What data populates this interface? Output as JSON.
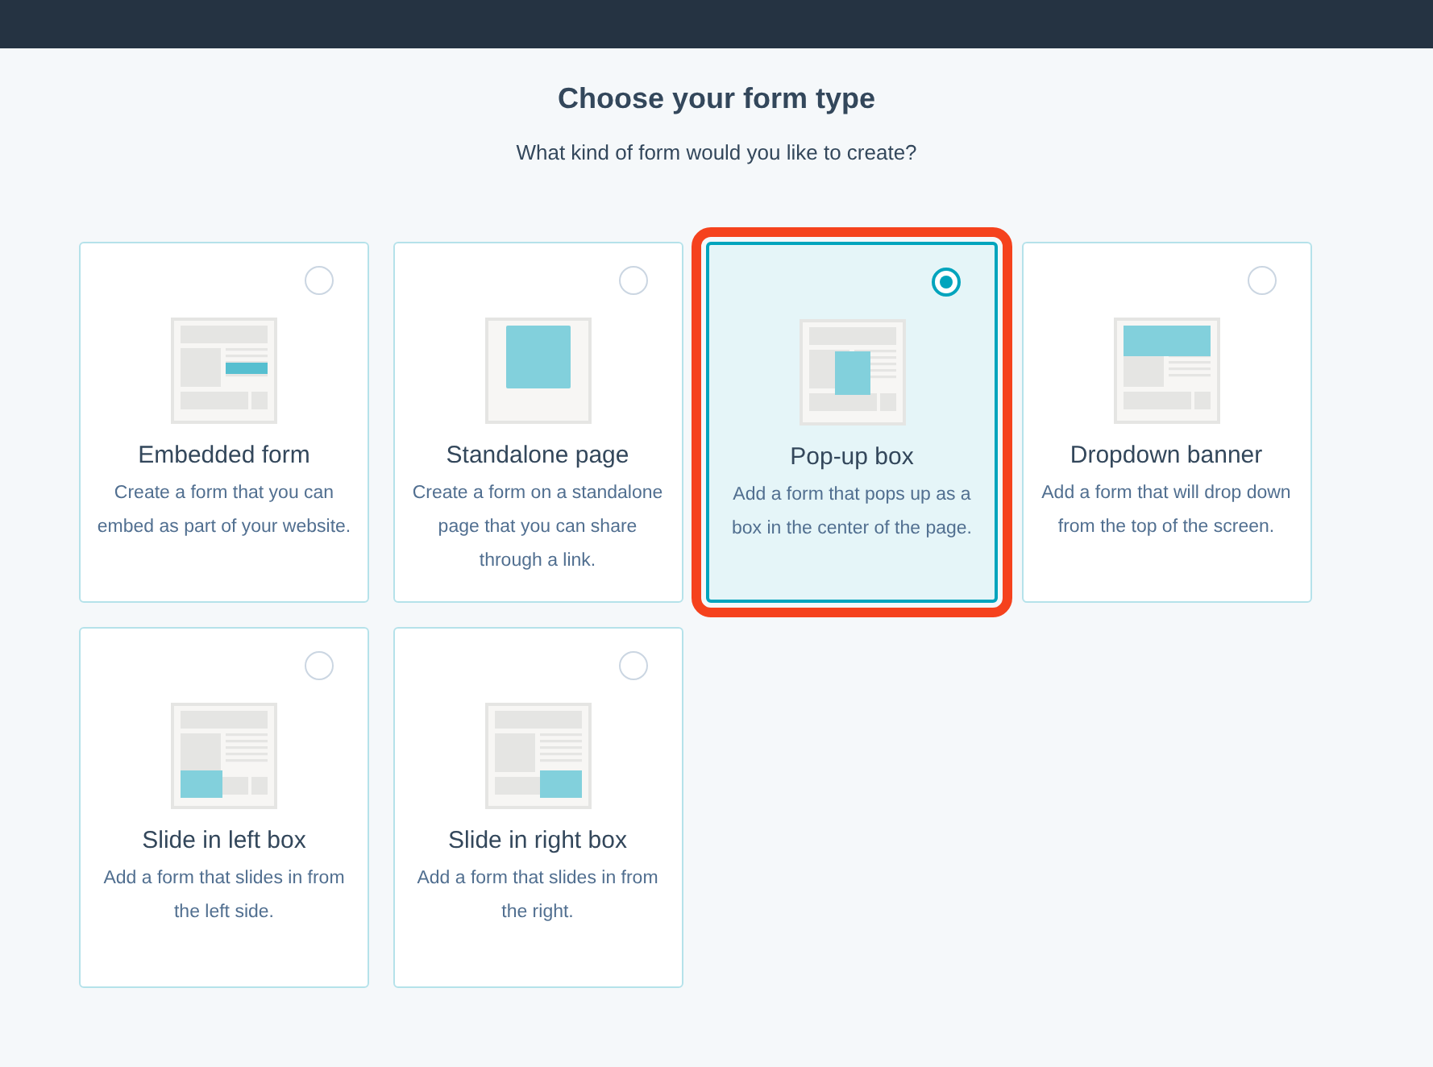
{
  "heading": "Choose your form type",
  "subheading": "What kind of form would you like to create?",
  "form_types": [
    {
      "kind": "embedded",
      "title": "Embedded form",
      "description": "Create a form that you can embed as part of your website.",
      "selected": false
    },
    {
      "kind": "standalone",
      "title": "Standalone page",
      "description": "Create a form on a standalone page that you can share through a link.",
      "selected": false
    },
    {
      "kind": "popup",
      "title": "Pop-up box",
      "description": "Add a form that pops up as a box in the center of the page.",
      "selected": true
    },
    {
      "kind": "dropdown",
      "title": "Dropdown banner",
      "description": "Add a form that will drop down from the top of the screen.",
      "selected": false
    },
    {
      "kind": "slide_left",
      "title": "Slide in left box",
      "description": "Add a form that slides in from the left side.",
      "selected": false
    },
    {
      "kind": "slide_right",
      "title": "Slide in right box",
      "description": "Add a form that slides in from the right.",
      "selected": false
    }
  ]
}
